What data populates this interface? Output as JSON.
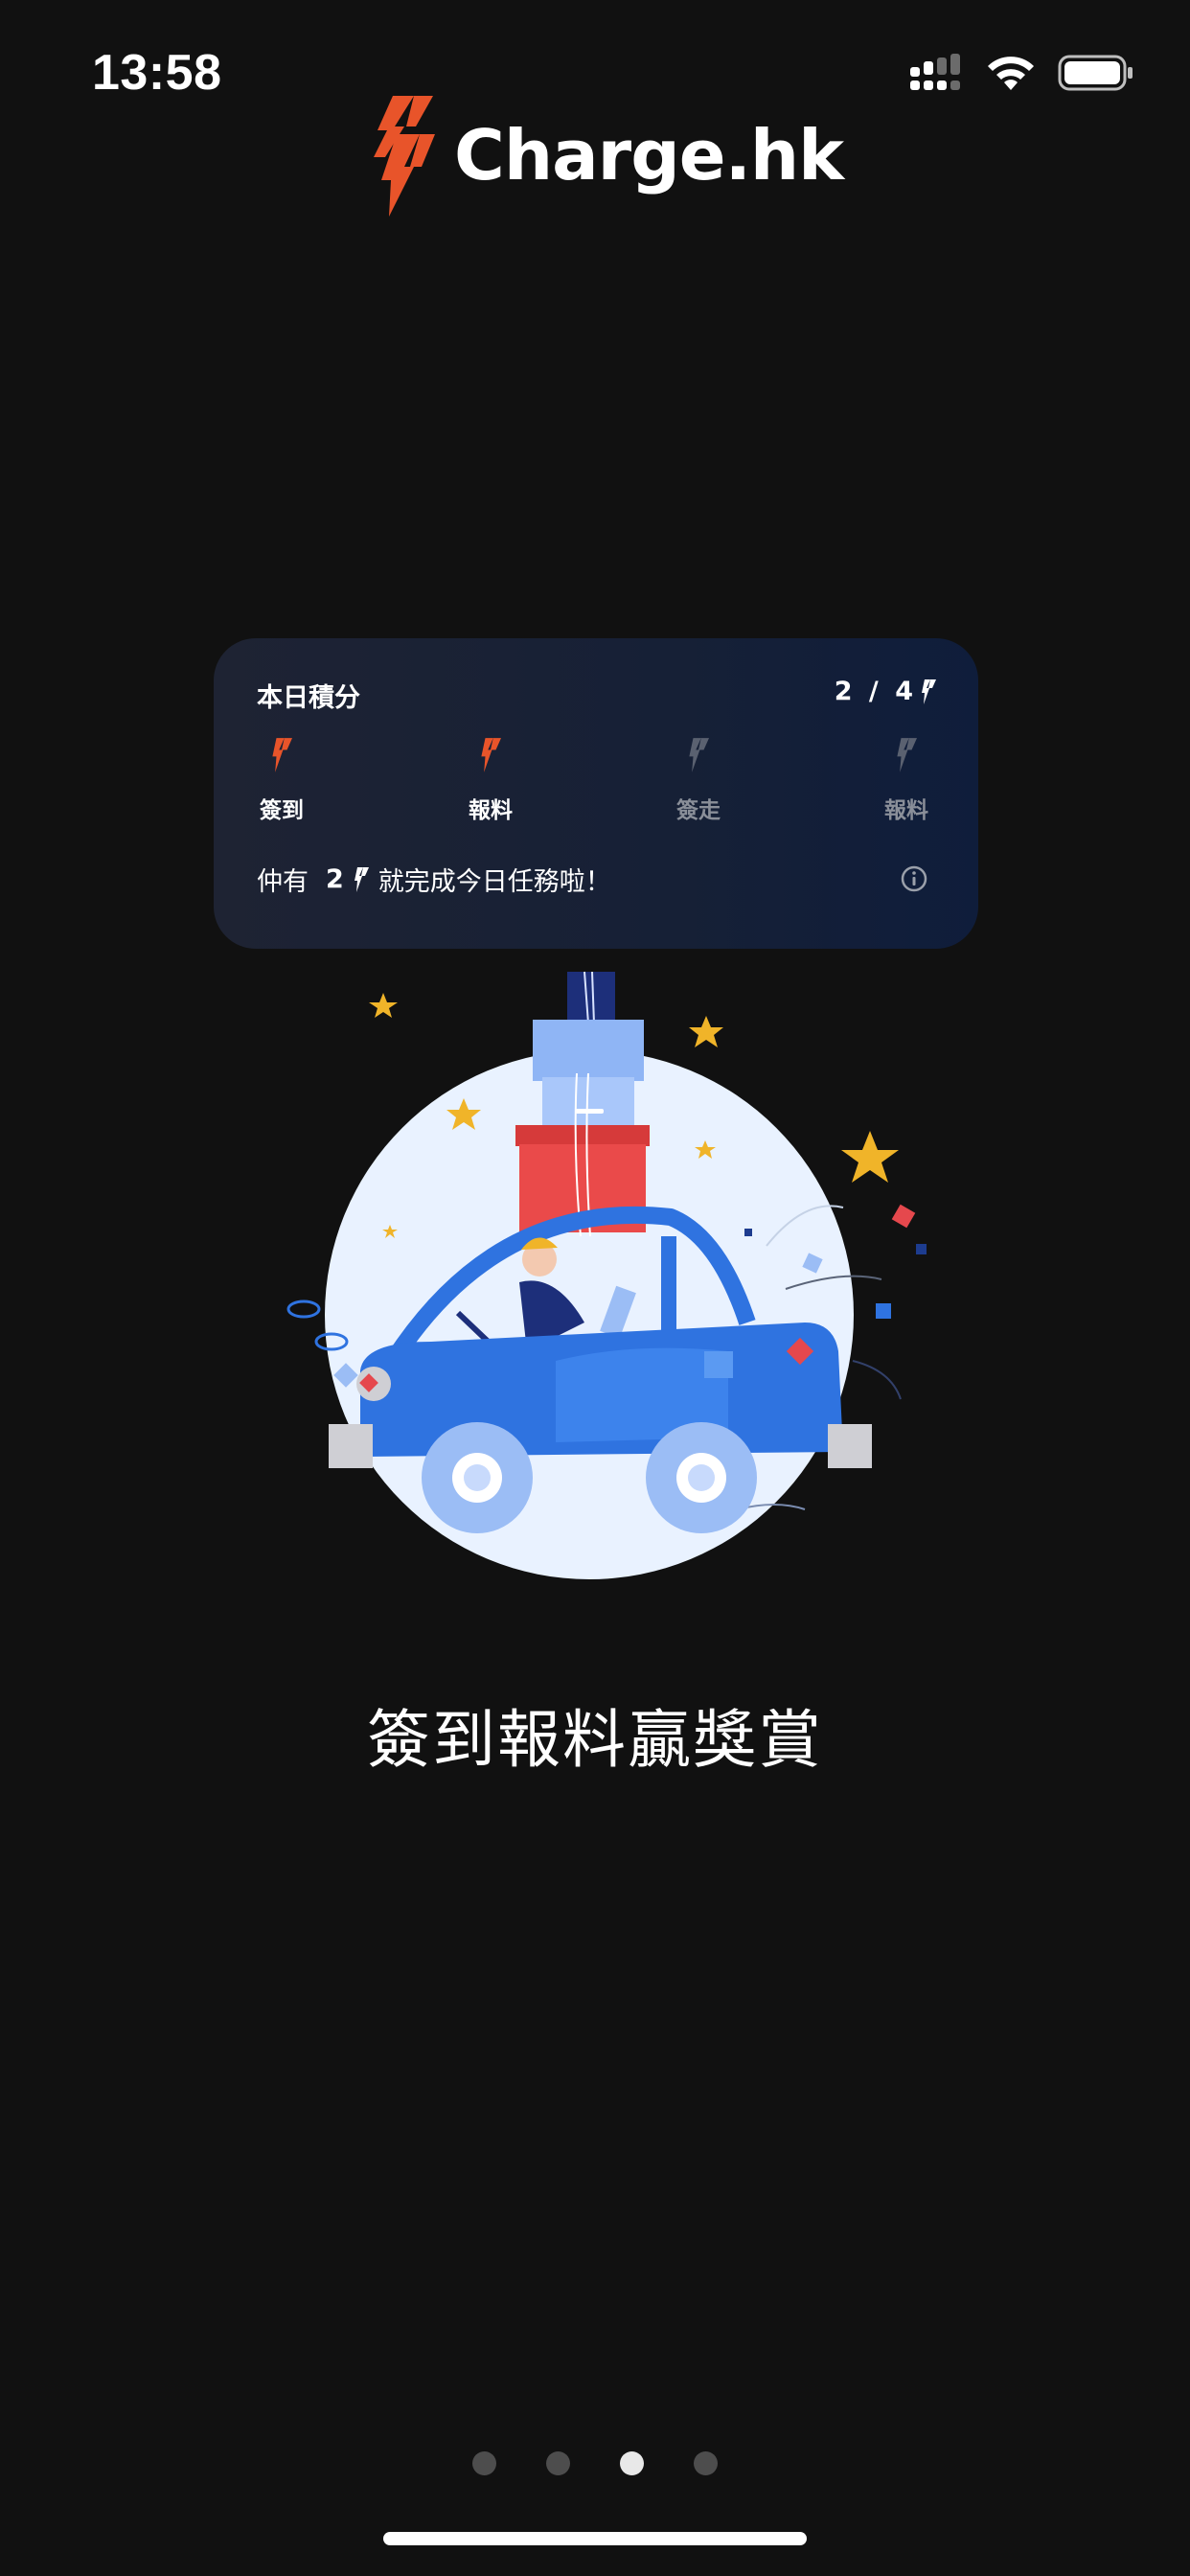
{
  "status_bar": {
    "time": "13:58",
    "icons": [
      "signal-icon",
      "wifi-icon",
      "battery-icon"
    ]
  },
  "brand": {
    "name": "Charge.hk",
    "logo_icon": "lightning-bolt-logo-icon",
    "accent_color": "#e8542a"
  },
  "points_card": {
    "title": "本日積分",
    "score_earned": "2",
    "score_total": "4",
    "score_separator": " / ",
    "tasks": [
      {
        "label": "簽到",
        "completed": true
      },
      {
        "label": "報料",
        "completed": true
      },
      {
        "label": "簽走",
        "completed": false
      },
      {
        "label": "報料",
        "completed": false
      }
    ],
    "message_prefix": "仲有",
    "message_count": "2",
    "message_suffix": "就完成今日任務啦！",
    "info_icon": "info-icon"
  },
  "onboarding": {
    "headline": "簽到報料贏獎賞",
    "illustration": "car-with-gift-boxes-illustration",
    "page_count": 4,
    "current_page": 3
  },
  "colors": {
    "background": "#111111",
    "card_background": "#1a2236",
    "bolt_active": "#e8542a",
    "bolt_inactive": "#5a6170",
    "dot_inactive": "#4d4d4d",
    "dot_active": "#e8e8e8"
  }
}
